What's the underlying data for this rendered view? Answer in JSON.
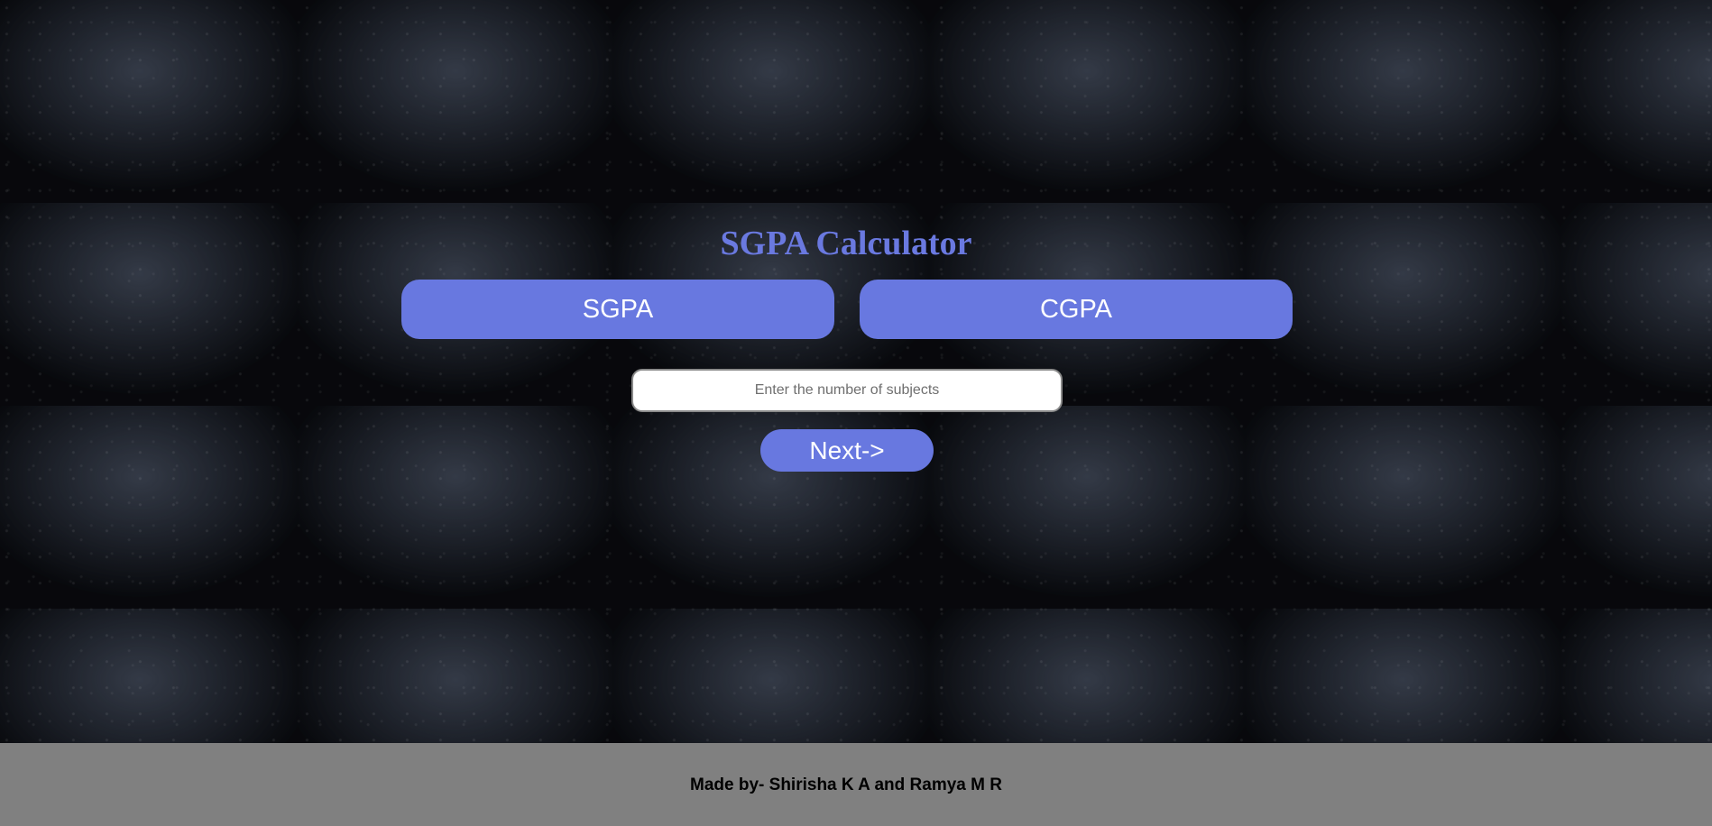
{
  "header": {
    "title": "SGPA Calculator"
  },
  "mode_buttons": {
    "sgpa_label": "SGPA",
    "cgpa_label": "CGPA"
  },
  "form": {
    "subjects_placeholder": "Enter the number of subjects",
    "subjects_value": "",
    "next_label": "Next->"
  },
  "footer": {
    "credit": "Made by- Shirisha K A and Ramya M R"
  },
  "colors": {
    "accent": "#6878e0",
    "footer_bg": "#808080",
    "page_bg": "#1b1f27"
  }
}
